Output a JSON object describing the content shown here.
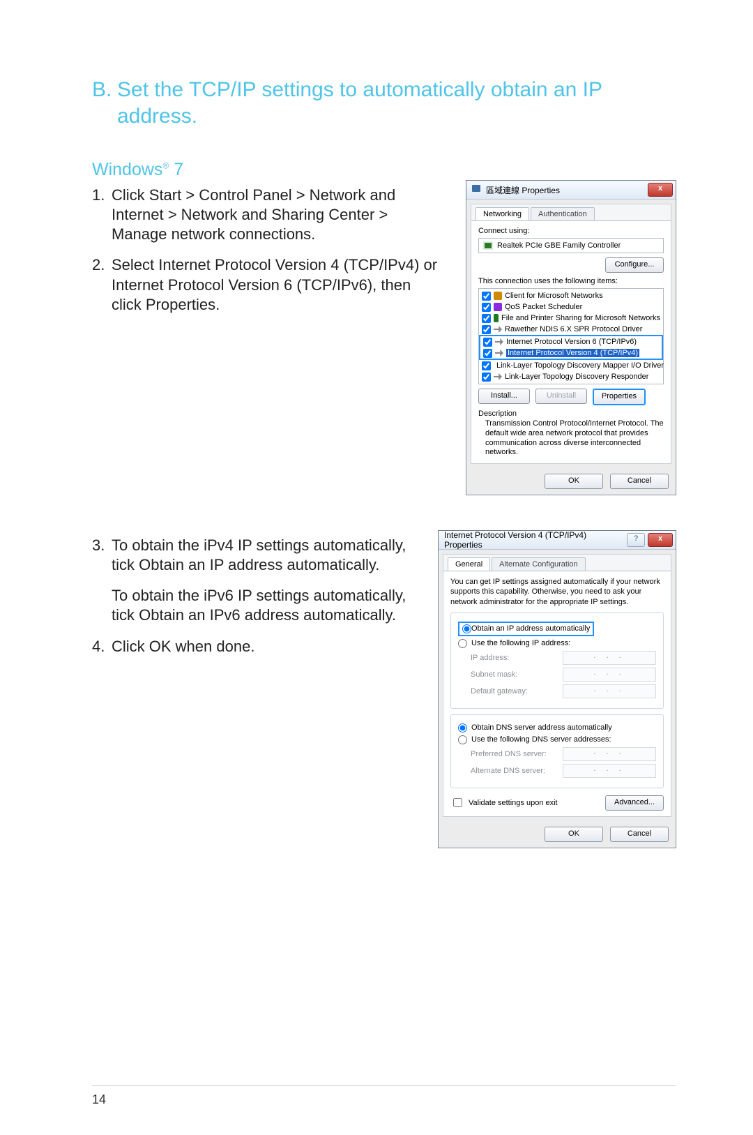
{
  "heading_letter": "B.",
  "heading_text": "Set the TCP/IP settings to automatically obtain an IP address.",
  "os_label": "Windows",
  "os_sup": "®",
  "os_ver": "7",
  "steps": {
    "s1": {
      "n": "1.",
      "t": "Click Start > Control Panel > Network and Internet > Network and Sharing Center > Manage network connections."
    },
    "s2": {
      "n": "2.",
      "t": "Select Internet Protocol Version 4 (TCP/IPv4) or Internet Protocol Version 6 (TCP/IPv6), then click Properties."
    },
    "s3": {
      "n": "3.",
      "t": "To obtain the iPv4 IP settings automatically, tick Obtain an IP address automatically."
    },
    "s3b": "To obtain the iPv6 IP settings automatically, tick Obtain an IPv6 address automatically.",
    "s4": {
      "n": "4.",
      "t": "Click OK when done."
    }
  },
  "dlg1": {
    "title": "區域連線 Properties",
    "tabs": {
      "a": "Networking",
      "b": "Authentication"
    },
    "connect_lbl": "Connect using:",
    "nic": "Realtek PCIe GBE Family Controller",
    "configure": "Configure...",
    "uses_lbl": "This connection uses the following items:",
    "items": {
      "i0": "Client for Microsoft Networks",
      "i1": "QoS Packet Scheduler",
      "i2": "File and Printer Sharing for Microsoft Networks",
      "i3": "Rawether NDIS 6.X SPR Protocol Driver",
      "i4": "Internet Protocol Version 6 (TCP/IPv6)",
      "i5": "Internet Protocol Version 4 (TCP/IPv4)",
      "i6": "Link-Layer Topology Discovery Mapper I/O Driver",
      "i7": "Link-Layer Topology Discovery Responder"
    },
    "install": "Install...",
    "uninstall": "Uninstall",
    "properties": "Properties",
    "desc_lbl": "Description",
    "desc_txt": "Transmission Control Protocol/Internet Protocol. The default wide area network protocol that provides communication across diverse interconnected networks.",
    "ok": "OK",
    "cancel": "Cancel"
  },
  "dlg2": {
    "title": "Internet Protocol Version 4 (TCP/IPv4) Properties",
    "tabs": {
      "a": "General",
      "b": "Alternate Configuration"
    },
    "intro": "You can get IP settings assigned automatically if your network supports this capability. Otherwise, you need to ask your network administrator for the appropriate IP settings.",
    "r_auto_ip": "Obtain an IP address automatically",
    "r_use_ip": "Use the following IP address:",
    "ip": "IP address:",
    "mask": "Subnet mask:",
    "gw": "Default gateway:",
    "r_auto_dns": "Obtain DNS server address automatically",
    "r_use_dns": "Use the following DNS server addresses:",
    "pdns": "Preferred DNS server:",
    "adns": "Alternate DNS server:",
    "dots": ".   .   .",
    "validate": "Validate settings upon exit",
    "advanced": "Advanced...",
    "ok": "OK",
    "cancel": "Cancel"
  },
  "pagenum": "14"
}
